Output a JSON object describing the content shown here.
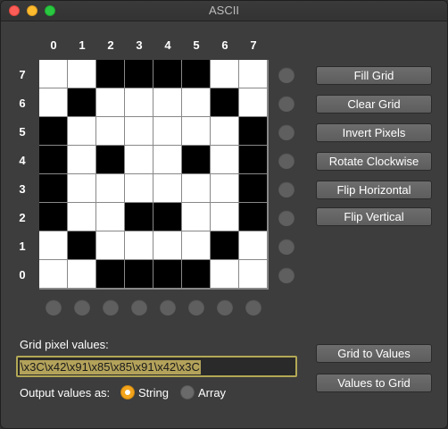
{
  "window": {
    "title": "ASCII"
  },
  "grid": {
    "col_labels": [
      "0",
      "1",
      "2",
      "3",
      "4",
      "5",
      "6",
      "7"
    ],
    "row_labels": [
      "7",
      "6",
      "5",
      "4",
      "3",
      "2",
      "1",
      "0"
    ],
    "pixels": [
      [
        0,
        0,
        1,
        1,
        1,
        1,
        0,
        0
      ],
      [
        0,
        1,
        0,
        0,
        0,
        0,
        1,
        0
      ],
      [
        1,
        0,
        0,
        0,
        0,
        0,
        0,
        1
      ],
      [
        1,
        0,
        1,
        0,
        0,
        1,
        0,
        1
      ],
      [
        1,
        0,
        0,
        0,
        0,
        0,
        0,
        1
      ],
      [
        1,
        0,
        0,
        1,
        1,
        0,
        0,
        1
      ],
      [
        0,
        1,
        0,
        0,
        0,
        0,
        1,
        0
      ],
      [
        0,
        0,
        1,
        1,
        1,
        1,
        0,
        0
      ]
    ],
    "on_color": "#000000",
    "off_color": "#ffffff"
  },
  "toolbar": {
    "fill_grid": "Fill Grid",
    "clear_grid": "Clear Grid",
    "invert_pixels": "Invert Pixels",
    "rotate_clockwise": "Rotate Clockwise",
    "flip_horizontal": "Flip Horizontal",
    "flip_vertical": "Flip Vertical"
  },
  "values": {
    "label": "Grid pixel values:",
    "text": "\\x3C\\x42\\x91\\x85\\x85\\x91\\x42\\x3C",
    "grid_to_values": "Grid to Values",
    "values_to_grid": "Values to Grid"
  },
  "output": {
    "label": "Output values as:",
    "options": [
      "String",
      "Array"
    ],
    "selected": "String"
  },
  "colors": {
    "focus_ring": "#b3a856",
    "selection": "#b3a25a",
    "radio_selected": "#f3a41b"
  }
}
